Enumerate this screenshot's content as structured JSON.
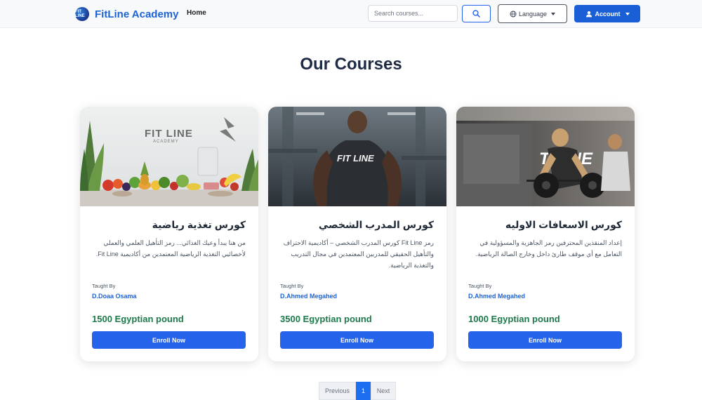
{
  "navbar": {
    "brand_name": "FitLine Academy",
    "brand_logo_text": "FIT LINE",
    "home_link": "Home",
    "search_placeholder": "Search courses...",
    "language_label": "Language",
    "account_label": "Account"
  },
  "page_title": "Our Courses",
  "taught_by_label": "Taught By",
  "courses": [
    {
      "title": "كورس تغذية رياضية",
      "description": "من هنا يبدأ وعيك الغذائي... رمز التأهيل العلمي والعملي لأخصائيي التغذية الرياضية المعتمدين من أكاديمية Fit Line.",
      "instructor": "D.Doaa Osama",
      "price": "1500 Egyptian pound",
      "enroll_label": "Enroll Now",
      "image_text": "FIT LINE",
      "image_subtext": "ACADEMY"
    },
    {
      "title": "كورس المدرب الشخصي",
      "description": "رمز Fit Line كورس المدرب الشخصي – أكاديمية الاحتراف والتأهيل الحقيقي للمدربين المعتمدين في مجال التدريب والتغذية الرياضية.",
      "instructor": "D.Ahmed Megahed",
      "price": "3500 Egyptian pound",
      "enroll_label": "Enroll Now",
      "image_text": "FIT LINE"
    },
    {
      "title": "كورس الاسعافات الاوليه",
      "description": "إعداد المنقذين المحترفين رمز الجاهزية والمسؤولية في التعامل مع أي موقف طارئ داخل وخارج الصالة الرياضية.",
      "instructor": "D.Ahmed Megahed",
      "price": "1000 Egyptian pound",
      "enroll_label": "Enroll Now",
      "image_text": "T LINE"
    }
  ],
  "pagination": {
    "previous": "Previous",
    "current_page": "1",
    "next": "Next"
  },
  "colors": {
    "brand": "#1e63d6",
    "primary_button": "#2563eb",
    "price": "#1d7a4a",
    "heading": "#1f2a44"
  }
}
